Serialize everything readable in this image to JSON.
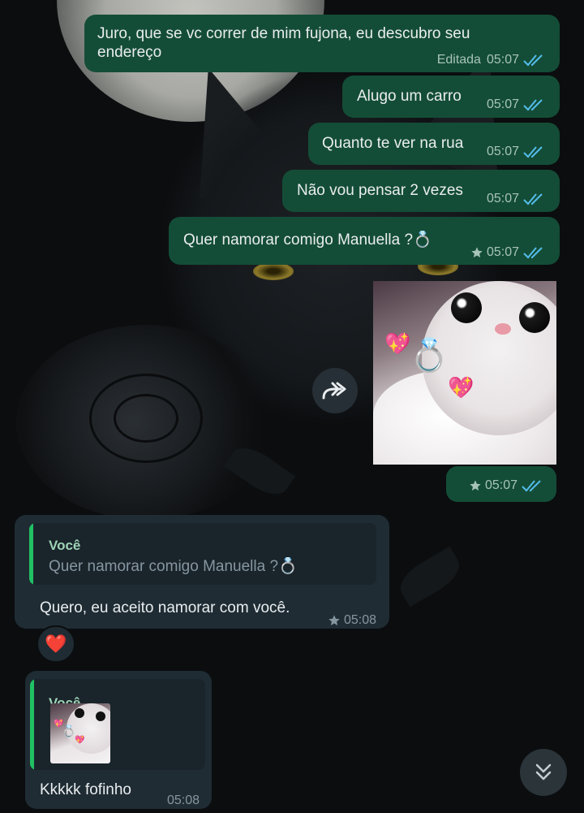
{
  "messages": [
    {
      "text": "Juro, que se vc correr de mim fujona, eu descubro seu\nendereço",
      "edited_label": "Editada",
      "time": "05:07"
    },
    {
      "text": "Alugo um carro",
      "time": "05:07"
    },
    {
      "text": "Quanto te ver na rua",
      "time": "05:07"
    },
    {
      "text": "Não vou pensar 2 vezes",
      "time": "05:07"
    },
    {
      "text": "Quer namorar comigo Manuella ?💍",
      "time": "05:07",
      "starred": true
    }
  ],
  "photo_message": {
    "time": "05:07",
    "starred": true
  },
  "reply_1": {
    "quote_author": "Você",
    "quote_text": "Quer namorar comigo Manuella ?💍",
    "text": "Quero, eu aceito namorar com você.",
    "time": "05:08",
    "starred": true,
    "reaction": "❤️"
  },
  "reply_2": {
    "quote_author": "Você",
    "text": "Kkkkk fofinho",
    "time": "05:08"
  },
  "colors": {
    "outgoing_bubble": "#144d37",
    "incoming_bubble": "#1f2c34",
    "read_ticks": "#53bdeb",
    "quote_bar": "#21c063"
  },
  "icons": {
    "forward": "forward-icon",
    "scroll_down": "double-chevron-down-icon",
    "read_receipt": "double-check-icon",
    "star": "star-icon"
  }
}
